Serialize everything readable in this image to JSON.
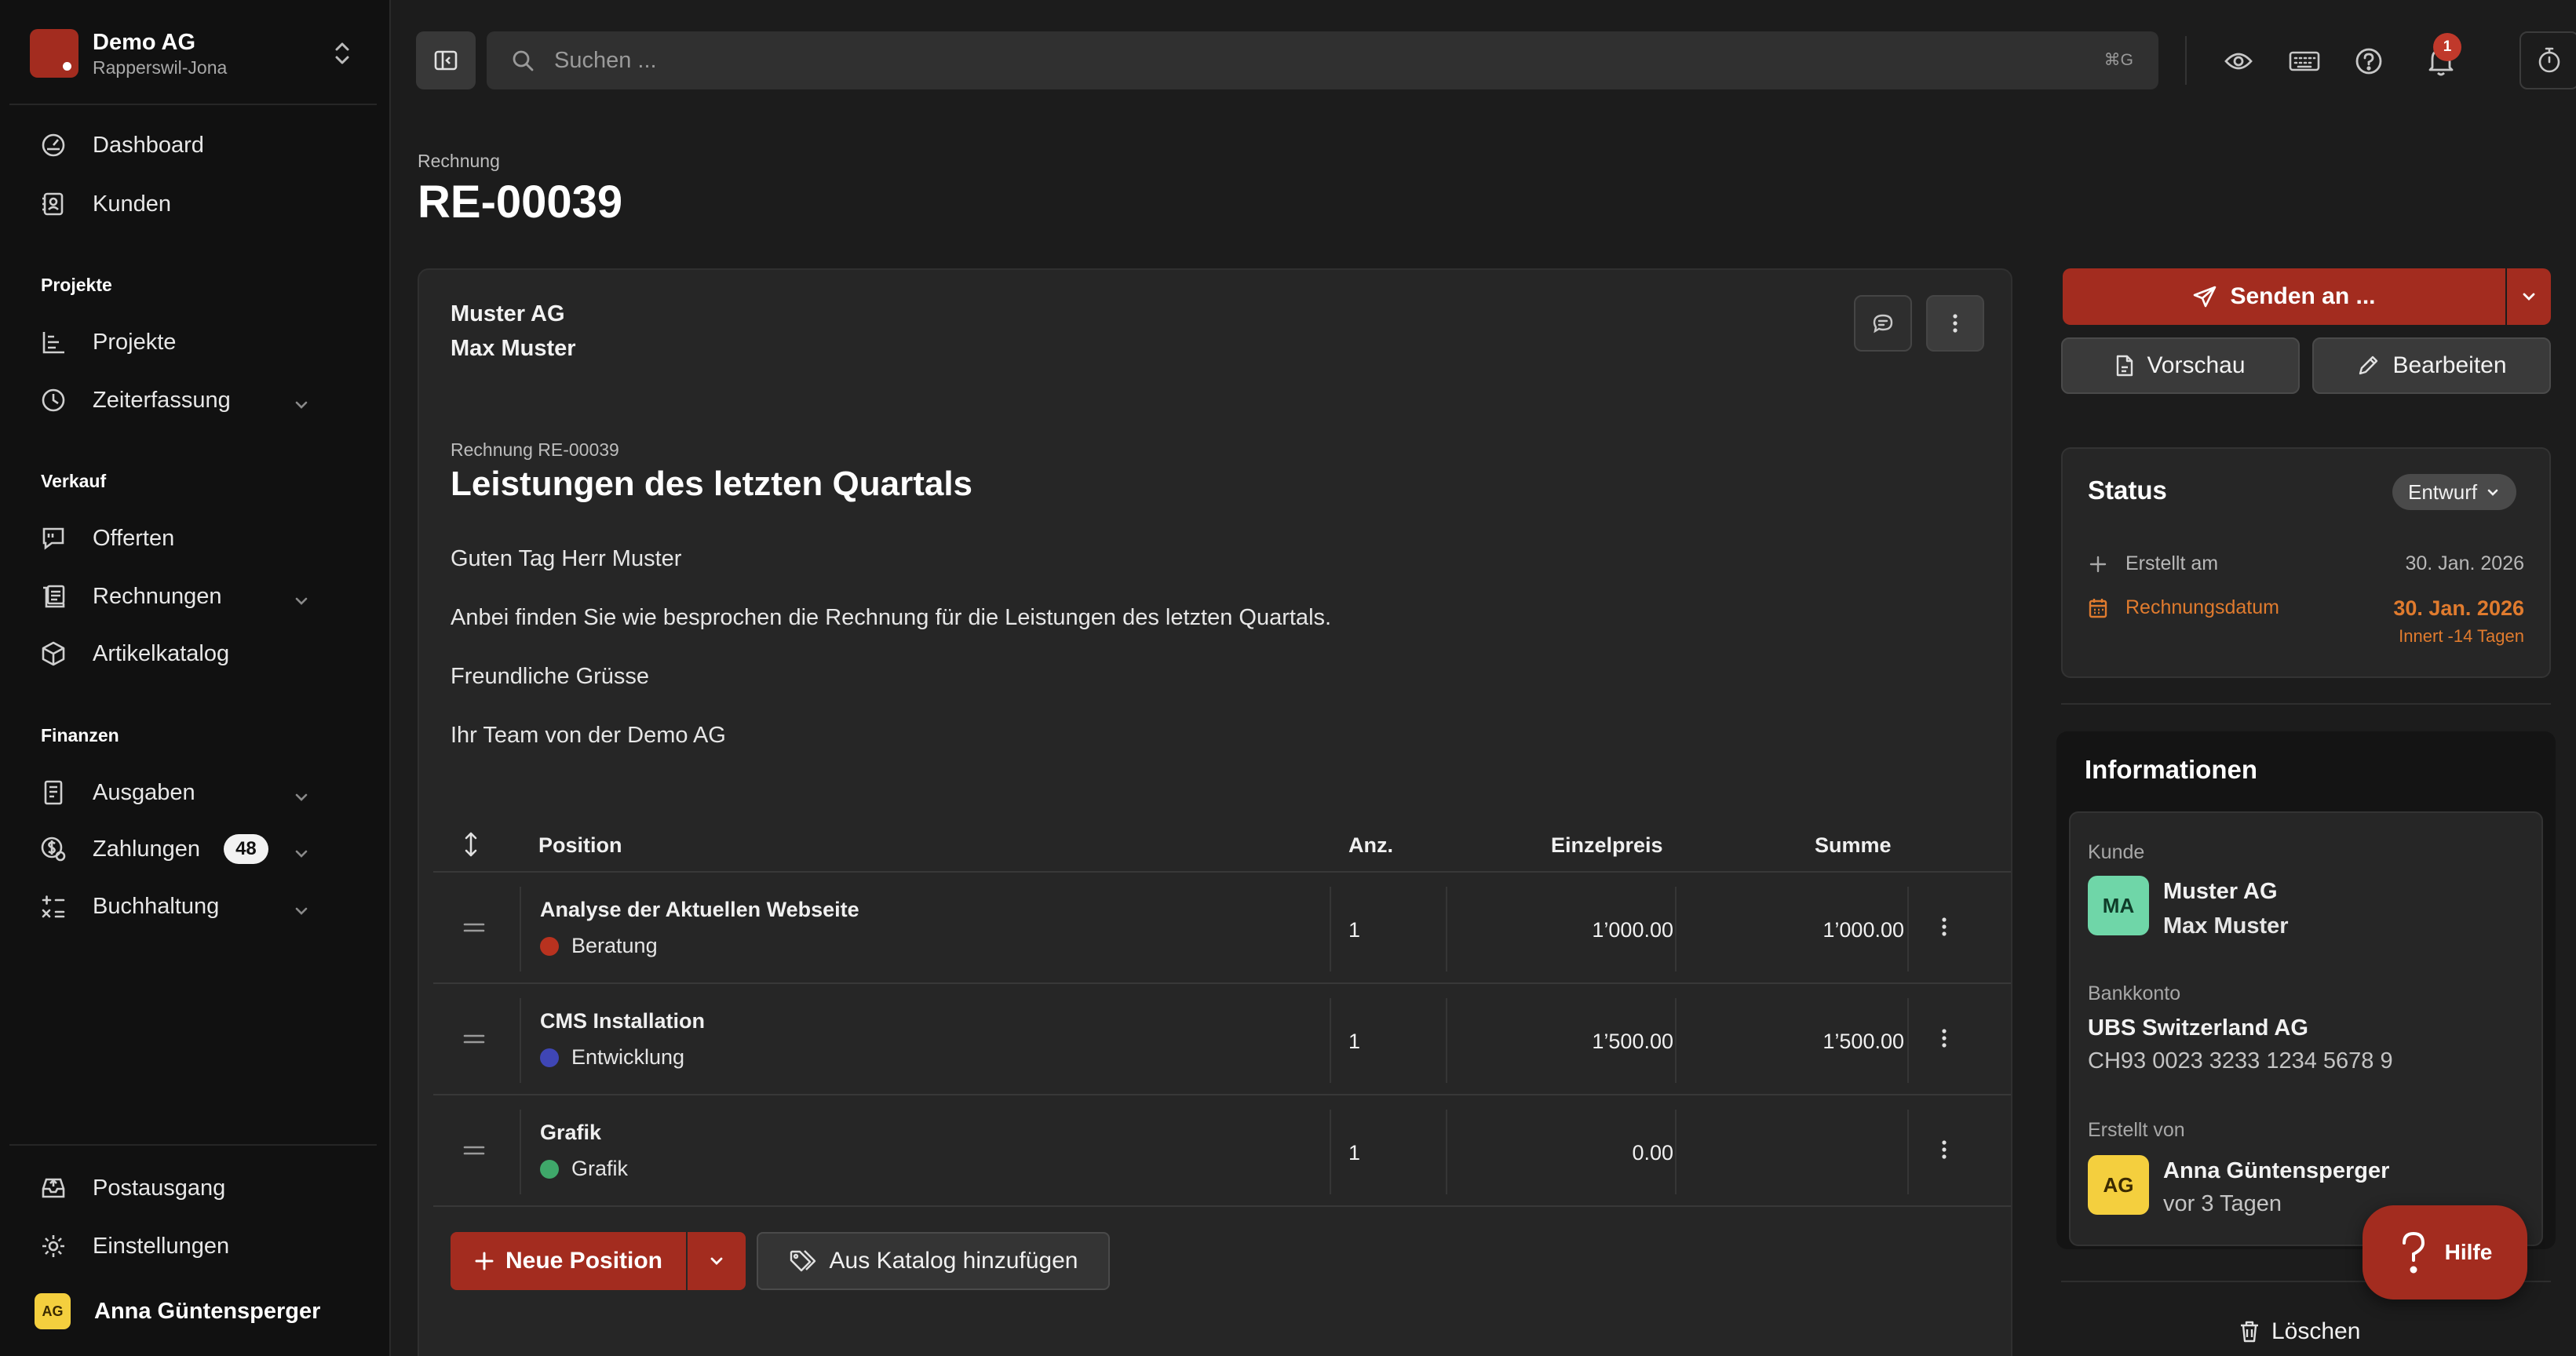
{
  "org": {
    "name": "Demo AG",
    "location": "Rapperswil-Jona"
  },
  "sidebar": {
    "top": [
      {
        "label": "Dashboard",
        "icon": "dashboard-icon"
      },
      {
        "label": "Kunden",
        "icon": "contacts-icon"
      }
    ],
    "sections": {
      "projekte": "Projekte",
      "verkauf": "Verkauf",
      "finanzen": "Finanzen"
    },
    "projekte": [
      {
        "label": "Projekte",
        "icon": "chart-icon"
      },
      {
        "label": "Zeiterfassung",
        "icon": "clock-icon"
      }
    ],
    "verkauf": [
      {
        "label": "Offerten",
        "icon": "quote-icon"
      },
      {
        "label": "Rechnungen",
        "icon": "invoice-icon"
      },
      {
        "label": "Artikelkatalog",
        "icon": "box-icon"
      }
    ],
    "finanzen": [
      {
        "label": "Ausgaben",
        "icon": "receipt-icon"
      },
      {
        "label": "Zahlungen",
        "icon": "payments-icon",
        "badge": "48"
      },
      {
        "label": "Buchhaltung",
        "icon": "accounting-icon"
      }
    ],
    "bottom": [
      {
        "label": "Postausgang",
        "icon": "outbox-icon"
      },
      {
        "label": "Einstellungen",
        "icon": "gear-icon"
      }
    ],
    "user": {
      "initials": "AG",
      "name": "Anna Güntensperger"
    }
  },
  "topbar": {
    "search_placeholder": "Suchen ...",
    "search_shortcut": "⌘G",
    "notification_count": "1"
  },
  "document": {
    "type": "Rechnung",
    "number": "RE-00039",
    "recipient_company": "Muster AG",
    "recipient_person": "Max Muster",
    "subtitle": "Rechnung RE-00039",
    "title": "Leistungen des letzten Quartals",
    "body": [
      "Guten Tag Herr Muster",
      "Anbei finden Sie wie besprochen die Rechnung für die Leistungen des letzten Quartals.",
      "Freundliche Grüsse",
      "Ihr Team von der Demo AG"
    ]
  },
  "table": {
    "headers": {
      "position": "Position",
      "qty": "Anz.",
      "unit": "Einzelpreis",
      "sum": "Summe"
    },
    "rows": [
      {
        "name": "Analyse der Aktuellen Webseite",
        "category": "Beratung",
        "color": "#b8321f",
        "qty": "1",
        "unit": "1’000.00",
        "sum": "1’000.00"
      },
      {
        "name": "CMS Installation",
        "category": "Entwicklung",
        "color": "#3f46b5",
        "qty": "1",
        "unit": "1’500.00",
        "sum": "1’500.00"
      },
      {
        "name": "Grafik",
        "category": "Grafik",
        "color": "#3fa86a",
        "qty": "1",
        "unit": "0.00",
        "sum": ""
      }
    ],
    "new_position": "Neue Position",
    "add_from_catalog": "Aus Katalog hinzufügen"
  },
  "actions": {
    "send": "Senden an ...",
    "preview": "Vorschau",
    "edit": "Bearbeiten",
    "delete": "Löschen",
    "help": "Hilfe"
  },
  "status": {
    "title": "Status",
    "value": "Entwurf",
    "created_label": "Erstellt am",
    "created_value": "30. Jan. 2026",
    "invoice_date_label": "Rechnungsdatum",
    "invoice_date_value": "30. Jan. 2026",
    "due_note": "Innert -14 Tagen"
  },
  "info": {
    "title": "Informationen",
    "customer_label": "Kunde",
    "customer_initials": "MA",
    "customer_company": "Muster AG",
    "customer_person": "Max Muster",
    "bank_label": "Bankkonto",
    "bank_name": "UBS Switzerland AG",
    "iban": "CH93 0023 3233 1234 5678 9",
    "created_by_label": "Erstellt von",
    "creator_initials": "AG",
    "creator_name": "Anna Güntensperger",
    "creator_when": "vor 3 Tagen"
  },
  "colors": {
    "accent": "#a32c1f",
    "warning": "#e07b2e",
    "customer_avatar": "#6fd6a8",
    "user_avatar": "#f4cf3e"
  }
}
